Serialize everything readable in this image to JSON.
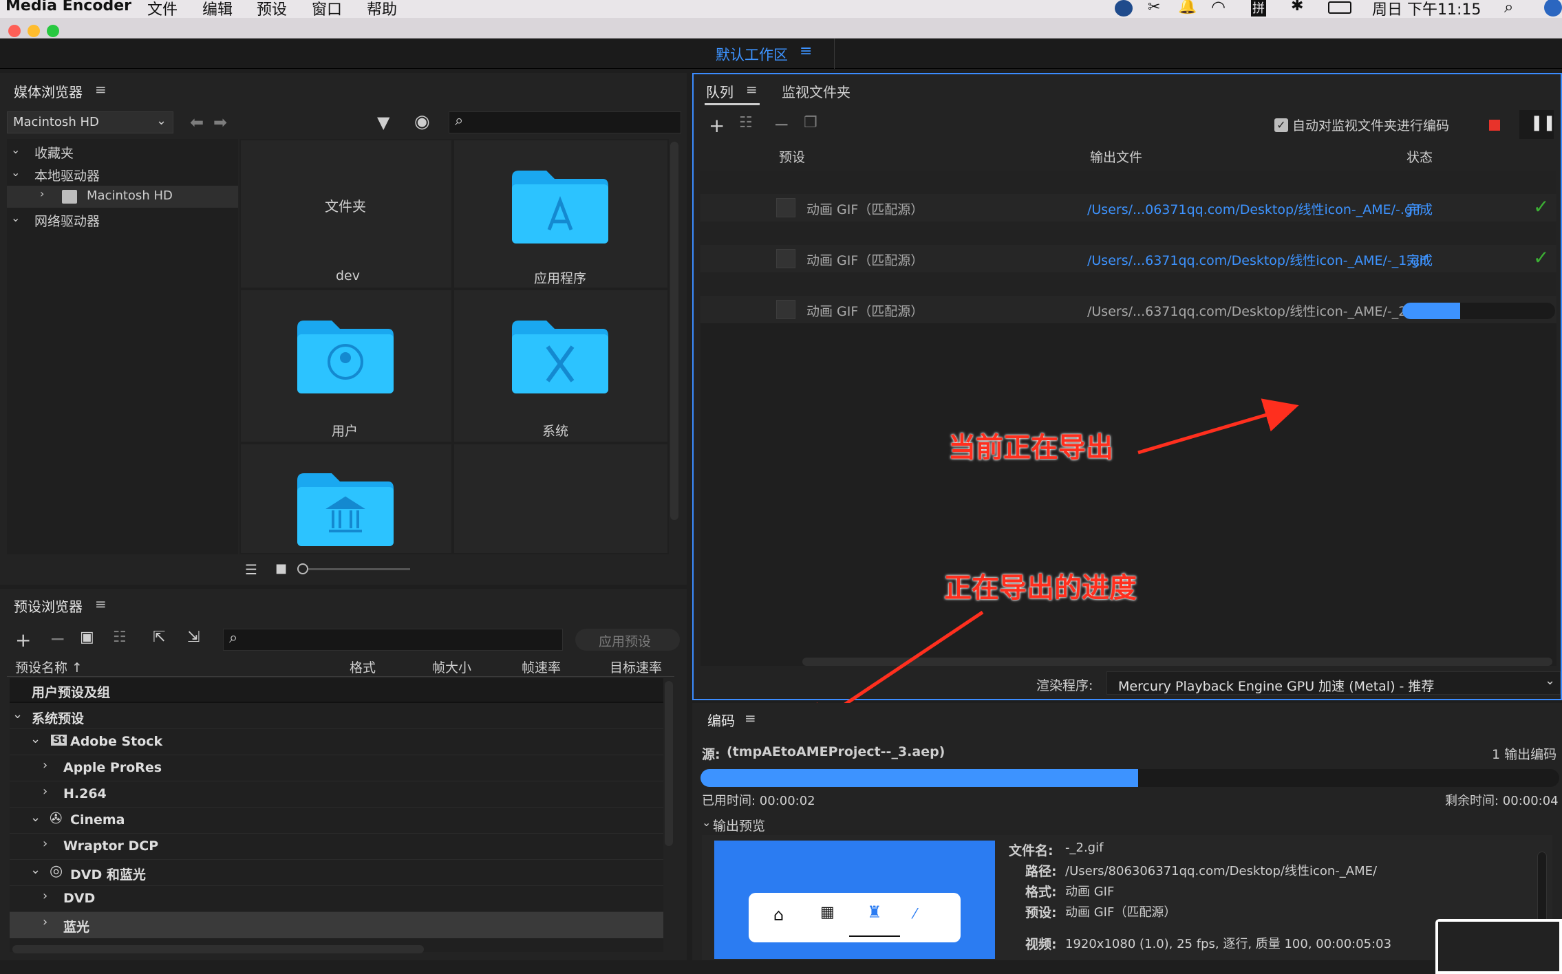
{
  "menubar": {
    "app_name": "Media Encoder",
    "menus": [
      "文件",
      "编辑",
      "预设",
      "窗口",
      "帮助"
    ],
    "clock": "周日 下午11:15",
    "input_method": "拼"
  },
  "workspace": {
    "title": "默认工作区"
  },
  "media_browser": {
    "title": "媒体浏览器",
    "drive_select": "Macintosh HD",
    "tree": [
      {
        "label": "收藏夹"
      },
      {
        "label": "本地驱动器"
      },
      {
        "label": "Macintosh HD"
      },
      {
        "label": "网络驱动器"
      }
    ],
    "grid": [
      {
        "top": "文件夹",
        "label": "dev"
      },
      {
        "label": "应用程序"
      },
      {
        "label": "用户"
      },
      {
        "label": "系统"
      },
      {
        "label": ""
      }
    ]
  },
  "preset_browser": {
    "title": "预设浏览器",
    "apply_button": "应用预设",
    "columns": [
      "预设名称 ↑",
      "格式",
      "帧大小",
      "帧速率",
      "目标速率"
    ],
    "rows": [
      {
        "label": "用户预设及组"
      },
      {
        "label": "系统预设"
      },
      {
        "label": "Adobe Stock",
        "badge": "St"
      },
      {
        "label": "Apple ProRes"
      },
      {
        "label": "H.264"
      },
      {
        "label": "Cinema"
      },
      {
        "label": "Wraptor DCP"
      },
      {
        "label": "DVD 和蓝光"
      },
      {
        "label": "DVD"
      },
      {
        "label": "蓝光"
      }
    ]
  },
  "queue": {
    "tabs": [
      "队列",
      "监视文件夹"
    ],
    "auto_encode_label": "自动对监视文件夹进行编码",
    "columns": [
      "预设",
      "输出文件",
      "状态"
    ],
    "items": [
      {
        "preset": "动画 GIF（匹配源）",
        "output": "/Users/...06371qq.com/Desktop/线性icon-_AME/-.gif",
        "status": "完成",
        "progress": 1.0
      },
      {
        "preset": "动画 GIF（匹配源）",
        "output": "/Users/...6371qq.com/Desktop/线性icon-_AME/-_1.gif",
        "status": "完成",
        "progress": 1.0
      },
      {
        "preset": "动画 GIF（匹配源）",
        "output": "/Users/...6371qq.com/Desktop/线性icon-_AME/-_2.gif",
        "status": "",
        "progress": 0.38
      }
    ],
    "annotation_current": "当前正在导出",
    "annotation_progress": "正在导出的进度",
    "renderer_label": "渲染程序:",
    "renderer_value": "Mercury Playback Engine GPU 加速 (Metal) - 推荐"
  },
  "encoding": {
    "title": "编码",
    "source_label": "源:",
    "source_value": "(tmpAEtoAMEProject--_3.aep)",
    "output_count": "1 输出编码",
    "progress": 0.51,
    "elapsed": "已用时间: 00:00:02",
    "remaining": "剩余时间: 00:00:04",
    "preview_label": "输出预览",
    "details": [
      {
        "key": "文件名:",
        "value": "-_2.gif"
      },
      {
        "key": "路径:",
        "value": "/Users/806306371qq.com/Desktop/线性icon-_AME/"
      },
      {
        "key": "格式:",
        "value": "动画 GIF"
      },
      {
        "key": "预设:",
        "value": "动画 GIF（匹配源）"
      },
      {
        "key": "视频:",
        "value": "1920x1080 (1.0), 25 fps, 逐行, 质量 100, 00:00:05:03"
      }
    ]
  },
  "colors": {
    "accent": "#3d93ff",
    "folder": "#1db4ff",
    "done_check": "#3cb034",
    "annotation": "#ff2f1e",
    "stop_red": "#e8332a"
  }
}
